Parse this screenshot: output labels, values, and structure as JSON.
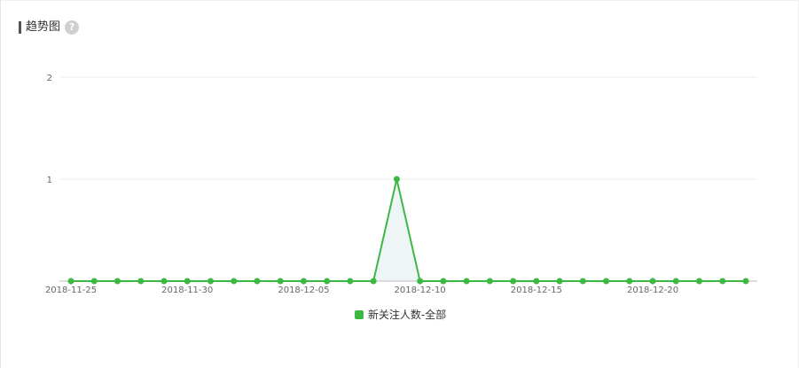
{
  "header": {
    "title": "趋势图",
    "help_icon": "question-icon",
    "help_glyph": "?"
  },
  "colors": {
    "series": "#3db843",
    "area_fill": "#eef5f7",
    "grid": "#eeeeee",
    "axis": "#bbbbbb",
    "help_icon_bg": "#cfcfcf"
  },
  "chart_data": {
    "type": "line",
    "x": [
      "2018-11-25",
      "2018-11-26",
      "2018-11-27",
      "2018-11-28",
      "2018-11-29",
      "2018-11-30",
      "2018-12-01",
      "2018-12-02",
      "2018-12-03",
      "2018-12-04",
      "2018-12-05",
      "2018-12-06",
      "2018-12-07",
      "2018-12-08",
      "2018-12-09",
      "2018-12-10",
      "2018-12-11",
      "2018-12-12",
      "2018-12-13",
      "2018-12-14",
      "2018-12-15",
      "2018-12-16",
      "2018-12-17",
      "2018-12-18",
      "2018-12-19",
      "2018-12-20",
      "2018-12-21",
      "2018-12-22",
      "2018-12-23",
      "2018-12-24"
    ],
    "x_tick_labels": [
      "2018-11-25",
      "2018-11-30",
      "2018-12-05",
      "2018-12-10",
      "2018-12-15",
      "2018-12-20"
    ],
    "y_ticks": [
      1,
      2
    ],
    "ylim": [
      0,
      2
    ],
    "grid": true,
    "legend_position": "bottom-center",
    "series": [
      {
        "name": "新关注人数-全部",
        "color": "#3db843",
        "values": [
          0,
          0,
          0,
          0,
          0,
          0,
          0,
          0,
          0,
          0,
          0,
          0,
          0,
          0,
          1,
          0,
          0,
          0,
          0,
          0,
          0,
          0,
          0,
          0,
          0,
          0,
          0,
          0,
          0,
          0
        ]
      }
    ]
  }
}
